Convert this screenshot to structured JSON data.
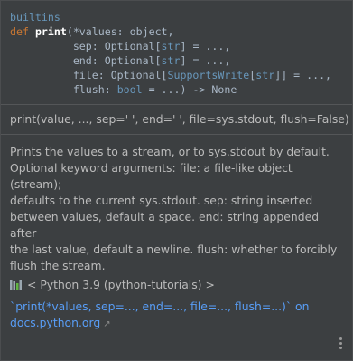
{
  "signature": {
    "module": "builtins",
    "def_kw": "def",
    "func_name": "print",
    "line1_params": "(*values: object,",
    "line2_name": "sep: Optional[",
    "line2_type": "str",
    "line2_rest": "] = ...,",
    "line3_name": "end: Optional[",
    "line3_type": "str",
    "line3_rest": "] = ...,",
    "line4_name": "file: Optional[",
    "line4_type1": "SupportsWrite",
    "line4_mid": "[",
    "line4_type2": "str",
    "line4_rest": "]] = ...,",
    "line5_name": "flush: ",
    "line5_type": "bool",
    "line5_rest": " = ...) -> None"
  },
  "short_signature": "print(value, ..., sep=' ', end=' ', file=sys.stdout, flush=False)",
  "doc_lines": [
    "Prints the values to a stream, or to sys.stdout by default.",
    "Optional keyword arguments: file: a file-like object (stream);",
    "defaults to the current sys.stdout. sep: string inserted",
    "between values, default a space. end: string appended after",
    "the last value, default a newline. flush: whether to forcibly",
    "flush the stream."
  ],
  "source_label": "< Python 3.9 (python-tutorials) >",
  "external_link": {
    "line1": "`print(*values, sep=..., end=..., file=..., flush=...)` on",
    "line2": "docs.python.org",
    "arrow": "↗"
  },
  "icons": {
    "library": "library-icon",
    "more": "more-options-icon"
  }
}
